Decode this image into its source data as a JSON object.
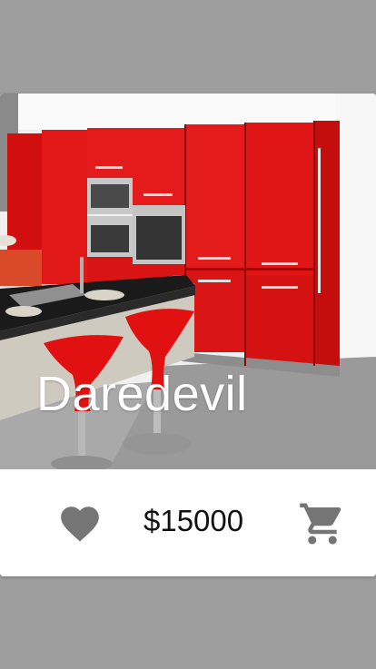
{
  "product": {
    "name": "Daredevil",
    "price": "$15000",
    "image_icon": "kitchen-photo"
  },
  "actions": {
    "favorite_icon": "heart-icon",
    "cart_icon": "shopping-cart-icon"
  },
  "colors": {
    "background": "#9e9e9e",
    "card": "#ffffff",
    "icon": "#757575",
    "price_text": "#111111",
    "title_text": "#ffffff"
  }
}
